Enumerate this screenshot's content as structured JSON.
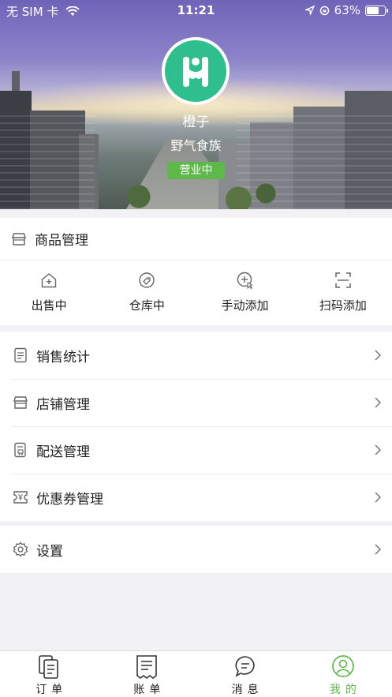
{
  "status_bar": {
    "carrier": "无 SIM 卡",
    "time": "11:21",
    "battery_percent": "63%",
    "battery_level": 0.63
  },
  "store": {
    "user": "橙子",
    "name": "野气食族",
    "status": "营业中",
    "logo_color": "#2fbf8f"
  },
  "goods": {
    "title": "商品管理",
    "actions": [
      {
        "label": "出售中",
        "icon": "house-plus-icon"
      },
      {
        "label": "仓库中",
        "icon": "tag-icon"
      },
      {
        "label": "手动添加",
        "icon": "manual-add-icon"
      },
      {
        "label": "扫码添加",
        "icon": "scan-icon"
      }
    ]
  },
  "menu": {
    "items": [
      {
        "label": "销售统计",
        "icon": "report-icon"
      },
      {
        "label": "店铺管理",
        "icon": "store-icon"
      },
      {
        "label": "配送管理",
        "icon": "delivery-icon"
      },
      {
        "label": "优惠券管理",
        "icon": "coupon-icon"
      }
    ]
  },
  "settings": {
    "label": "设置",
    "icon": "gear-icon"
  },
  "tabbar": {
    "items": [
      {
        "label": "订单",
        "icon": "orders-icon"
      },
      {
        "label": "账单",
        "icon": "bill-icon"
      },
      {
        "label": "消息",
        "icon": "message-icon"
      },
      {
        "label": "我的",
        "icon": "profile-icon"
      }
    ],
    "active_color": "#5fb84a"
  }
}
